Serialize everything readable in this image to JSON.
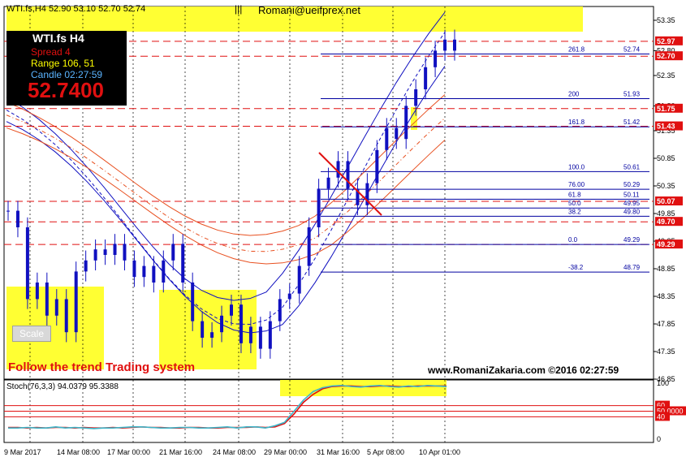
{
  "window": {
    "title_line": "WTI.fs,H4  52.90 53.10 52.70 52.74",
    "pipes": "|||",
    "email": "Romani@ueifprex.net"
  },
  "info_box": {
    "symbol": "WTI.fs   H4",
    "spread": "Spread   4",
    "range": "Range    106, 51",
    "candle": "Candle   02:27:59",
    "price": "52.7400"
  },
  "scale_button": "Scale",
  "footer": {
    "left": "Follow the trend Trading system",
    "right": "www.RomaniZakaria.com  ©2016  02:27:59"
  },
  "colors": {
    "candle": "#1010c0",
    "hline_red": "#e01010",
    "fib_blue": "#0000a0",
    "highlight": "#ffff33",
    "box_black": "#000000",
    "price_tag_red": "#e01010",
    "stoch_main": "#3cb5c8",
    "stoch_signal": "#e01010"
  },
  "chart_data": [
    {
      "type": "line",
      "title": "WTI.fs,H4",
      "ylim": [
        46.85,
        53.6
      ],
      "price_axis_ticks": [
        "53.35",
        "52.80",
        "52.35",
        "51.80",
        "51.35",
        "50.85",
        "50.35",
        "49.85",
        "49.35",
        "48.85",
        "48.35",
        "47.85",
        "47.35",
        "46.85"
      ],
      "x_tick_labels": [
        "9 Mar 2017",
        "14 Mar 08:00",
        "17 Mar 00:00",
        "21 Mar 16:00",
        "24 Mar 08:00",
        "29 Mar 00:00",
        "31 Mar 16:00",
        "5 Apr 08:00",
        "10 Apr 01:00"
      ],
      "horizontal_levels": [
        {
          "label": "52.97",
          "value": 52.97,
          "tag": true
        },
        {
          "label": "52.70",
          "value": 52.7,
          "tag": true
        },
        {
          "label": "51.75",
          "value": 51.75,
          "tag": true
        },
        {
          "label": "51.43",
          "value": 51.43,
          "tag": true
        },
        {
          "label": "50.07",
          "value": 50.07,
          "tag": true
        },
        {
          "label": "49.70",
          "value": 49.7,
          "tag": true
        },
        {
          "label": "49.29",
          "value": 49.29,
          "tag": true
        }
      ],
      "fibonacci_levels": [
        {
          "ratio": "261.8",
          "value": "52.74"
        },
        {
          "ratio": "200",
          "value": "51.93"
        },
        {
          "ratio": "161.8",
          "value": "51.42"
        },
        {
          "ratio": "100.0",
          "value": "50.61"
        },
        {
          "ratio": "76.00",
          "value": "50.29"
        },
        {
          "ratio": "61.8",
          "value": "50.11"
        },
        {
          "ratio": "50.0",
          "value": "49.95"
        },
        {
          "ratio": "38.2",
          "value": "49.80"
        },
        {
          "ratio": "0.0",
          "value": "49.29"
        },
        {
          "ratio": "-38.2",
          "value": "48.79"
        }
      ],
      "series": [
        {
          "name": "close",
          "values": [
            49.9,
            49.6,
            48.3,
            48.6,
            48.0,
            48.3,
            47.7,
            48.8,
            49.0,
            49.2,
            49.1,
            49.3,
            49.0,
            48.7,
            48.9,
            48.6,
            49.0,
            49.3,
            48.6,
            47.9,
            47.6,
            47.7,
            48.0,
            48.2,
            47.5,
            47.8,
            47.4,
            47.9,
            48.3,
            48.4,
            48.9,
            49.6,
            50.3,
            50.5,
            50.8,
            50.3,
            50.0,
            50.4,
            51.0,
            51.4,
            51.2,
            51.8,
            52.1,
            52.5,
            52.8,
            53.0,
            52.8
          ]
        }
      ]
    },
    {
      "type": "line",
      "title": "Stoch(76,3,3) 94.0379 95.3388",
      "ylim": [
        0,
        100
      ],
      "axis_ticks": [
        "100",
        "60",
        "50.0000",
        "40",
        "0"
      ],
      "levels": [
        60,
        50,
        40
      ],
      "series": [
        {
          "name": "Stoch main",
          "values": [
            20,
            20,
            21,
            20,
            20,
            22,
            20,
            21,
            20,
            19,
            20,
            20,
            21,
            22,
            22,
            21,
            20,
            20,
            21,
            21,
            20,
            20,
            21,
            22,
            20,
            22,
            22,
            20,
            24,
            30,
            50,
            70,
            85,
            92,
            95,
            96,
            94,
            93,
            95,
            96,
            94,
            93,
            95,
            94,
            96,
            95,
            94
          ]
        },
        {
          "name": "Stoch signal",
          "values": [
            21,
            21,
            20,
            21,
            20,
            21,
            21,
            20,
            21,
            20,
            20,
            21,
            20,
            21,
            22,
            21,
            21,
            20,
            20,
            21,
            21,
            20,
            20,
            21,
            21,
            21,
            22,
            21,
            22,
            28,
            45,
            66,
            80,
            90,
            94,
            95,
            95,
            94,
            94,
            95,
            95,
            94,
            94,
            95,
            95,
            95,
            95
          ]
        }
      ]
    }
  ]
}
